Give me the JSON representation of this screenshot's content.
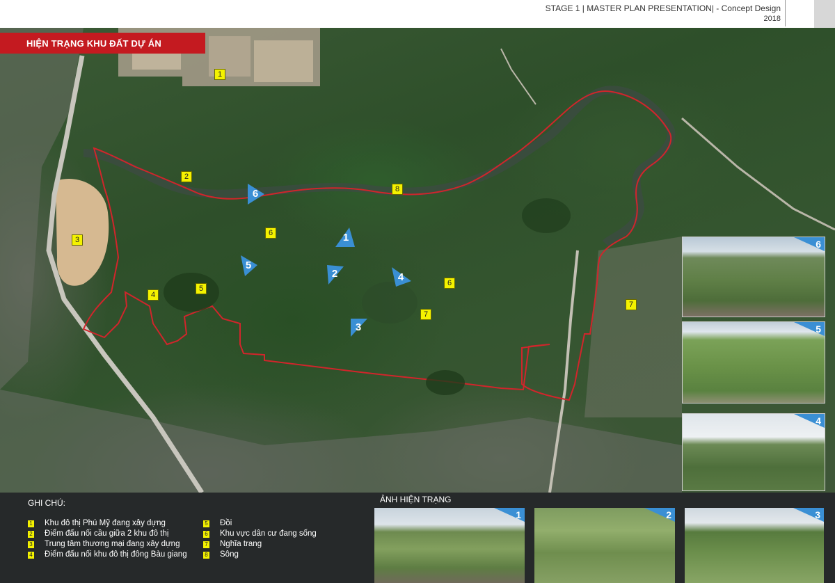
{
  "header": {
    "title": "STAGE 1 | MASTER PLAN  PRESENTATION| - Concept Design",
    "year": "2018"
  },
  "banner": {
    "title": "HIỆN TRẠNG KHU ĐẤT DỰ ÁN"
  },
  "map_markers": [
    {
      "label": "1"
    },
    {
      "label": "2"
    },
    {
      "label": "3"
    },
    {
      "label": "4"
    },
    {
      "label": "5"
    },
    {
      "label": "6"
    },
    {
      "label": "6"
    },
    {
      "label": "7"
    },
    {
      "label": "7"
    },
    {
      "label": "8"
    }
  ],
  "view_arrows": [
    {
      "label": "6"
    },
    {
      "label": "1"
    },
    {
      "label": "5"
    },
    {
      "label": "2"
    },
    {
      "label": "4"
    },
    {
      "label": "3"
    }
  ],
  "side_photos": [
    {
      "number": "6"
    },
    {
      "number": "5"
    },
    {
      "number": "4"
    }
  ],
  "legend": {
    "heading": "GHI CHÚ:",
    "items": [
      {
        "num": "1",
        "text": "Khu đô thị Phú Mỹ đang xây dựng"
      },
      {
        "num": "2",
        "text": "Điểm đấu nối cầu giữa 2 khu đô thị"
      },
      {
        "num": "3",
        "text": "Trung tâm thương mại đang xây dựng"
      },
      {
        "num": "4",
        "text": "Điểm đấu nối khu đô thị đông Bàu giang"
      },
      {
        "num": "5",
        "text": "Đồi"
      },
      {
        "num": "6",
        "text": "Khu vực dân cư đang sống"
      },
      {
        "num": "7",
        "text": "Nghĩa trang"
      },
      {
        "num": "8",
        "text": "Sông"
      }
    ]
  },
  "current_photos": {
    "heading": "ẢNH HIỆN TRẠNG",
    "items": [
      {
        "number": "1"
      },
      {
        "number": "2"
      },
      {
        "number": "3"
      }
    ]
  },
  "colors": {
    "banner_red": "#c41a20",
    "boundary_red": "#d1252b",
    "marker_yellow": "#f4f200",
    "arrow_blue": "#3a8fd4"
  }
}
